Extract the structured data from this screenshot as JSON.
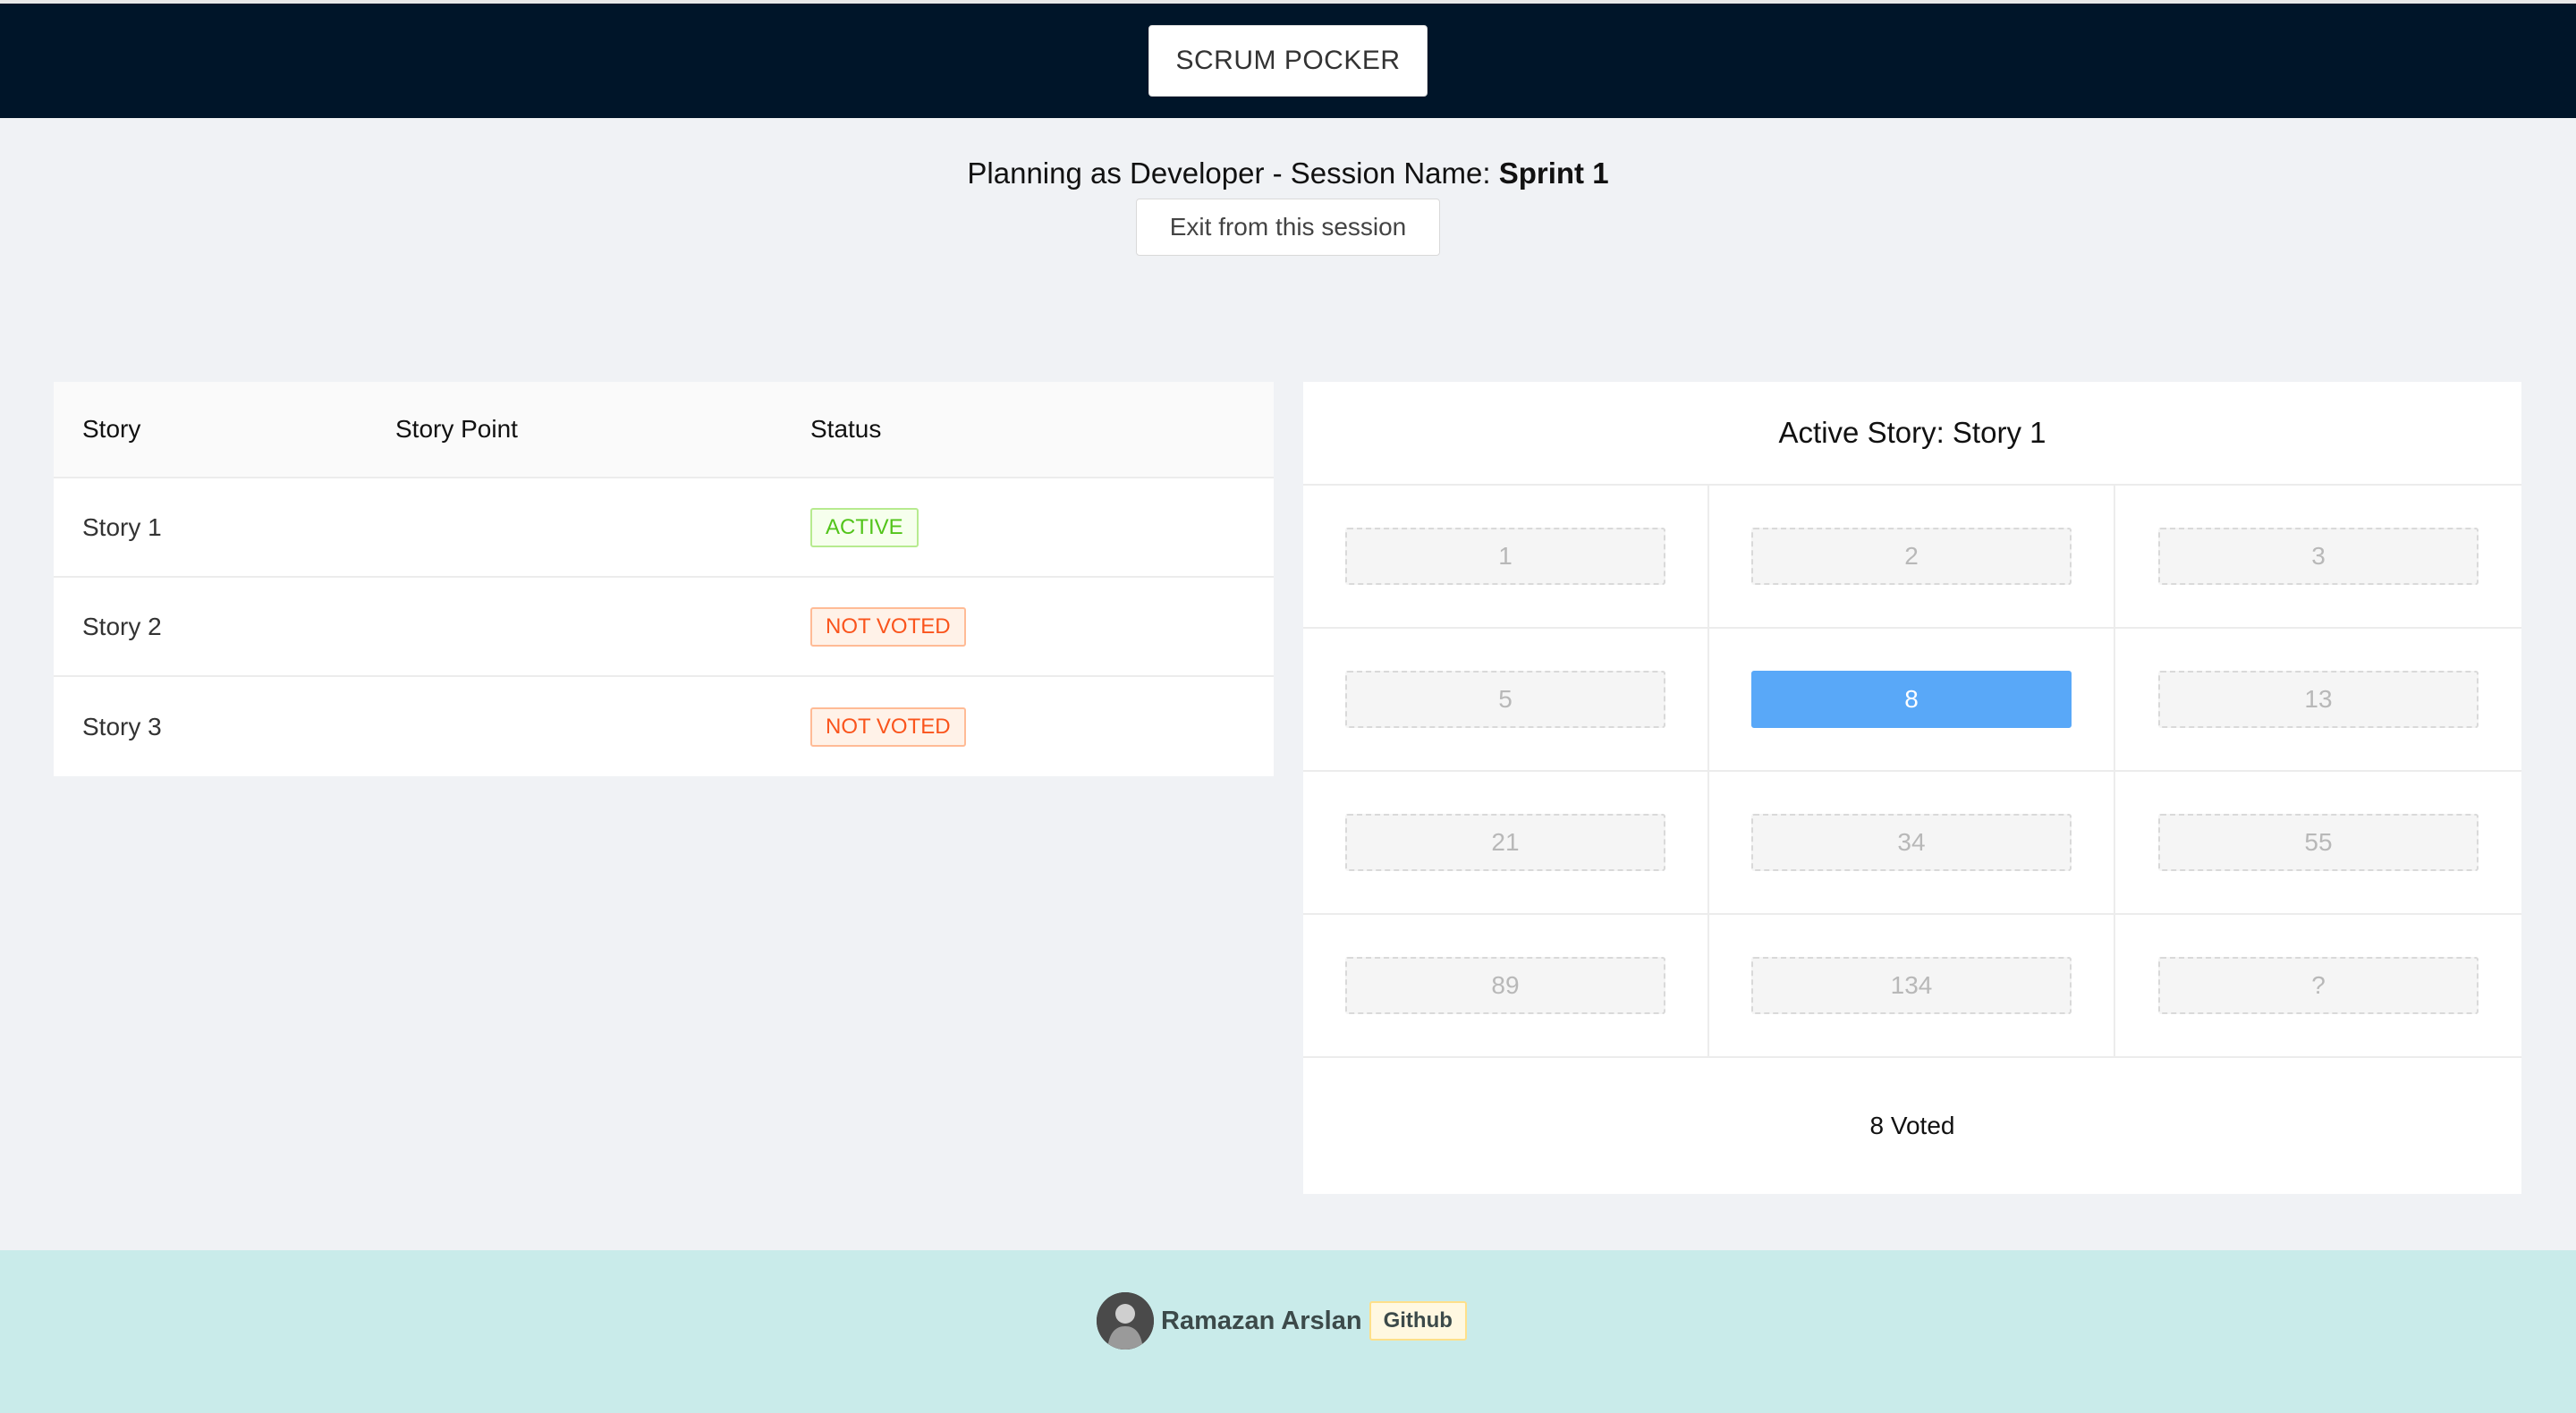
{
  "header": {
    "brand_label": "SCRUM POCKER"
  },
  "session": {
    "prefix": "Planning as Developer - Session Name: ",
    "name": "Sprint 1",
    "exit_label": "Exit from this session"
  },
  "stories_table": {
    "columns": [
      "Story",
      "Story Point",
      "Status"
    ],
    "rows": [
      {
        "story": "Story 1",
        "point": "",
        "status": "ACTIVE"
      },
      {
        "story": "Story 2",
        "point": "",
        "status": "NOT VOTED"
      },
      {
        "story": "Story 3",
        "point": "",
        "status": "NOT VOTED"
      }
    ]
  },
  "vote_panel": {
    "title": "Active Story: Story 1",
    "cards": [
      "1",
      "2",
      "3",
      "5",
      "8",
      "13",
      "21",
      "34",
      "55",
      "89",
      "134",
      "?"
    ],
    "selected": "8",
    "voted_text": "8 Voted"
  },
  "footer": {
    "author": "Ramazan Arslan",
    "link_label": "Github"
  },
  "colors": {
    "header_bg": "#001529",
    "selected_card": "#59a8f8",
    "active_tag": "#52c41a",
    "not_voted_tag": "#fa541c",
    "footer_bg": "#c9ebea"
  }
}
